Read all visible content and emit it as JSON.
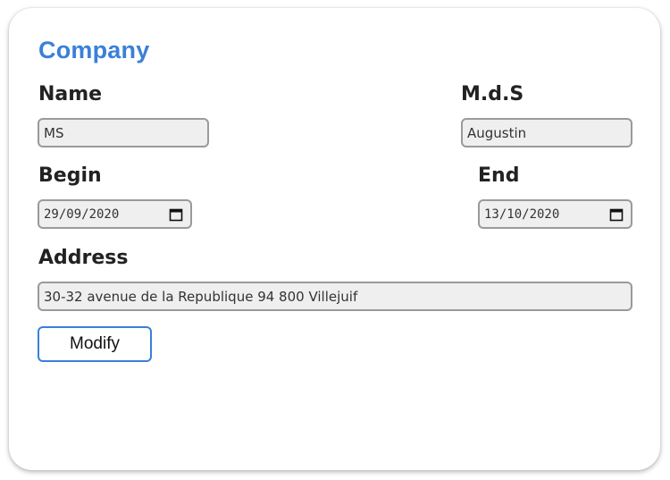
{
  "form": {
    "title": "Company",
    "name_label": "Name",
    "name_value": "MS",
    "mds_label": "M.d.S",
    "mds_value": "Augustin",
    "begin_label": "Begin",
    "begin_value": "29/09/2020",
    "end_label": "End",
    "end_value": "13/10/2020",
    "address_label": "Address",
    "address_value": "30-32 avenue de la Republique 94 800 Villejuif",
    "modify_label": "Modify"
  },
  "icons": {
    "begin_calendar": "calendar-icon",
    "end_calendar": "calendar-icon"
  },
  "colors": {
    "accent": "#3a80d8",
    "field_bg": "#efefef",
    "field_border": "#9a9a9a",
    "text": "#222222"
  }
}
